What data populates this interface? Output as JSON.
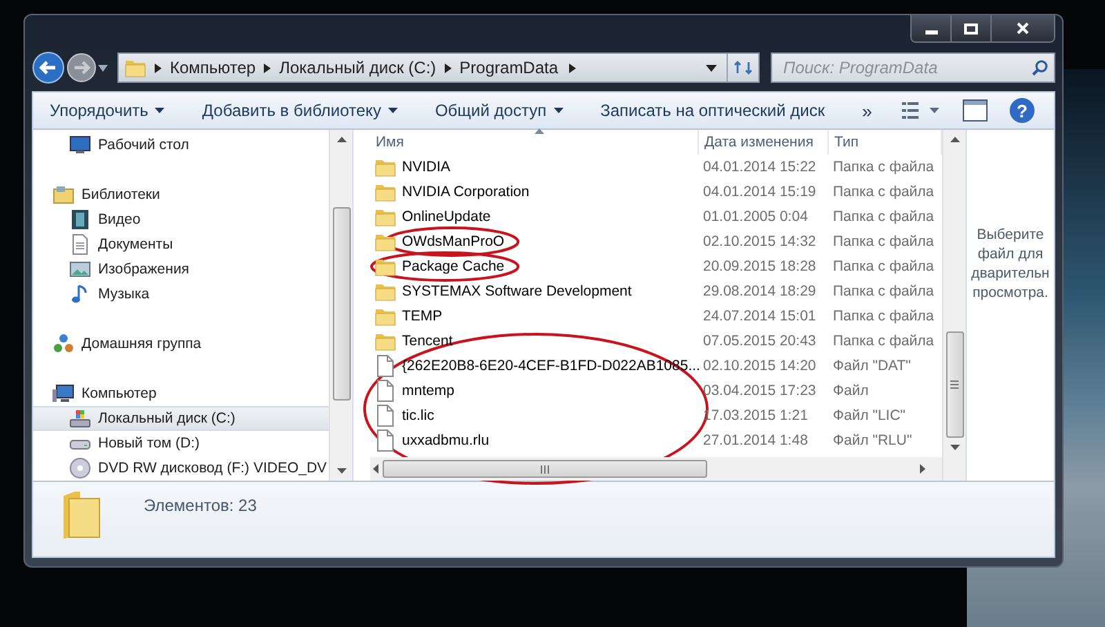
{
  "address_bar": {
    "path": [
      "Компьютер",
      "Локальный диск (C:)",
      "ProgramData"
    ]
  },
  "search": {
    "placeholder": "Поиск: ProgramData"
  },
  "toolbar": {
    "items": [
      {
        "label": "Упорядочить",
        "dropdown": true
      },
      {
        "label": "Добавить в библиотеку",
        "dropdown": true
      },
      {
        "label": "Общий доступ",
        "dropdown": true
      },
      {
        "label": "Записать на оптический диск",
        "dropdown": false
      }
    ],
    "overflow": "»",
    "help": "?"
  },
  "sidebar": {
    "items": [
      {
        "children": [
          {
            "label": "Рабочий стол",
            "kind": "desktop",
            "selected": false
          }
        ]
      },
      {
        "label": "Библиотеки",
        "kind": "libraries",
        "selected": false,
        "children": [
          {
            "label": "Видео",
            "kind": "video",
            "selected": false
          },
          {
            "label": "Документы",
            "kind": "documents",
            "selected": false
          },
          {
            "label": "Изображения",
            "kind": "pictures",
            "selected": false
          },
          {
            "label": "Музыка",
            "kind": "music",
            "selected": false
          }
        ]
      },
      {
        "label": "Домашняя группа",
        "kind": "homegroup",
        "selected": false
      },
      {
        "label": "Компьютер",
        "kind": "computer",
        "selected": false,
        "children": [
          {
            "label": "Локальный диск (C:)",
            "kind": "systemdrive",
            "selected": true
          },
          {
            "label": "Новый том (D:)",
            "kind": "drive",
            "selected": false
          },
          {
            "label": "DVD RW дисковод (F:) VIDEO_DV",
            "kind": "dvd",
            "selected": false
          }
        ]
      }
    ]
  },
  "files": {
    "columns": [
      {
        "label": "Имя",
        "sorted": true
      },
      {
        "label": "Дата изменения",
        "sorted": false
      },
      {
        "label": "Тип",
        "sorted": false
      }
    ],
    "rows": [
      {
        "name": "NVIDIA",
        "date": "04.01.2014 15:22",
        "type": "Папка с файла",
        "kind": "folder",
        "circled": false,
        "group_circled": false
      },
      {
        "name": "NVIDIA Corporation",
        "date": "04.01.2014 15:19",
        "type": "Папка с файла",
        "kind": "folder",
        "circled": false,
        "group_circled": false
      },
      {
        "name": "OnlineUpdate",
        "date": "01.01.2005 0:04",
        "type": "Папка с файла",
        "kind": "folder",
        "circled": false,
        "group_circled": false
      },
      {
        "name": "OWdsManProO",
        "date": "02.10.2015 14:32",
        "type": "Папка с файла",
        "kind": "folder",
        "circled": true,
        "group_circled": false
      },
      {
        "name": "Package Cache",
        "date": "20.09.2015 18:28",
        "type": "Папка с файла",
        "kind": "folder",
        "circled": true,
        "group_circled": false
      },
      {
        "name": "SYSTEMAX Software Development",
        "date": "29.08.2014 18:29",
        "type": "Папка с файла",
        "kind": "folder",
        "circled": false,
        "group_circled": false
      },
      {
        "name": "TEMP",
        "date": "24.07.2014 15:01",
        "type": "Папка с файла",
        "kind": "folder",
        "circled": false,
        "group_circled": false
      },
      {
        "name": "Tencent",
        "date": "07.05.2015 20:43",
        "type": "Папка с файла",
        "kind": "folder",
        "circled": false,
        "group_circled": false
      },
      {
        "name": "{262E20B8-6E20-4CEF-B1FD-D022AB1085...",
        "date": "02.10.2015 14:20",
        "type": "Файл \"DAT\"",
        "kind": "file",
        "circled": false,
        "group_circled": true
      },
      {
        "name": "mntemp",
        "date": "03.04.2015 17:23",
        "type": "Файл",
        "kind": "file",
        "circled": false,
        "group_circled": true
      },
      {
        "name": "tic.lic",
        "date": "17.03.2015 1:21",
        "type": "Файл \"LIC\"",
        "kind": "file",
        "circled": false,
        "group_circled": true
      },
      {
        "name": "uxxadbmu.rlu",
        "date": "27.01.2014 1:48",
        "type": "Файл \"RLU\"",
        "kind": "file",
        "circled": false,
        "group_circled": true
      }
    ]
  },
  "preview": {
    "lines": [
      "Выберите",
      "файл для",
      "дварительн",
      "просмотра."
    ]
  },
  "status_bar": {
    "count": "Элементов: 23"
  }
}
